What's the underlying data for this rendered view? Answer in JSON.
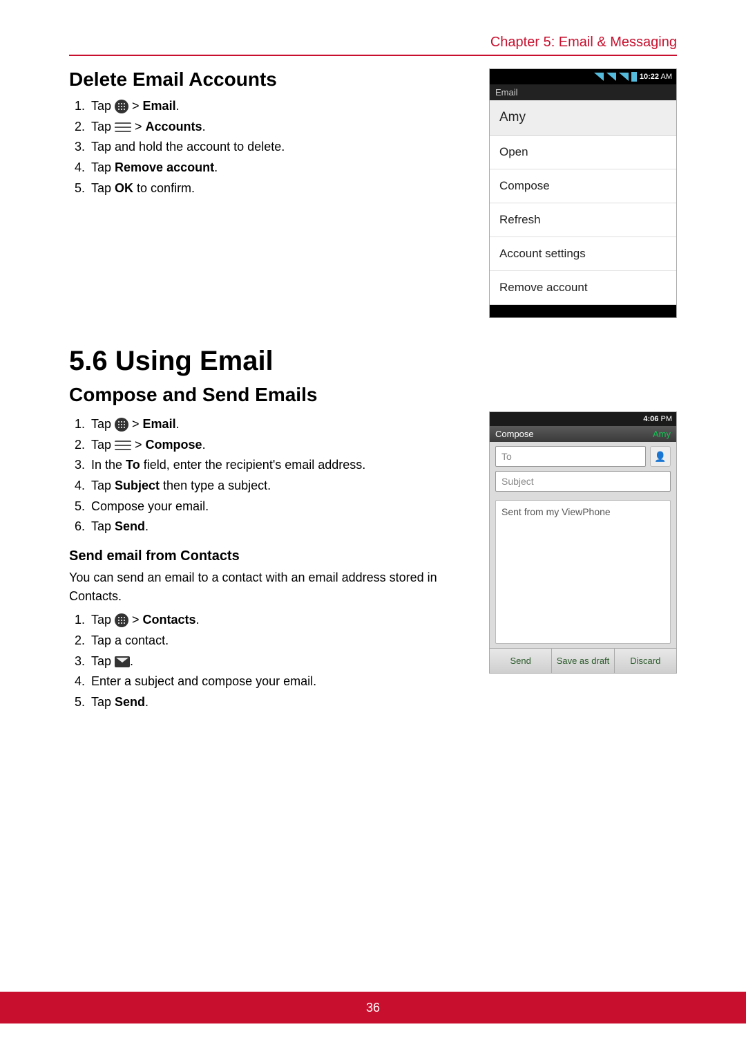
{
  "header": {
    "chapter": "Chapter 5: Email & Messaging"
  },
  "sectionA": {
    "title": "Delete Email Accounts",
    "steps": {
      "s1a": "Tap ",
      "s1b": " > ",
      "s1c": "Email",
      "s1d": ".",
      "s2a": "Tap ",
      "s2b": " > ",
      "s2c": "Accounts",
      "s2d": ".",
      "s3": "Tap and hold the account to delete.",
      "s4a": "Tap ",
      "s4b": "Remove account",
      "s4c": ".",
      "s5a": "Tap ",
      "s5b": "OK",
      "s5c": " to confirm."
    }
  },
  "phone1": {
    "time": "10:22",
    "ampm": "AM",
    "appbar": "Email",
    "header": "Amy",
    "items": [
      "Open",
      "Compose",
      "Refresh",
      "Account settings",
      "Remove account"
    ]
  },
  "major": {
    "title": "5.6 Using Email"
  },
  "sectionB": {
    "title": "Compose and Send Emails",
    "steps": {
      "s1a": "Tap ",
      "s1b": " > ",
      "s1c": "Email",
      "s1d": ".",
      "s2a": "Tap ",
      "s2b": " > ",
      "s2c": "Compose",
      "s2d": ".",
      "s3a": "In the ",
      "s3b": "To",
      "s3c": " field, enter the recipient's email address.",
      "s4a": "Tap ",
      "s4b": "Subject",
      "s4c": " then type a subject.",
      "s5": "Compose your email.",
      "s6a": "Tap ",
      "s6b": "Send",
      "s6c": "."
    },
    "subTitle": "Send email from Contacts",
    "subIntro": "You can send an email to a contact with an email address stored in Contacts.",
    "subSteps": {
      "s1a": "Tap ",
      "s1b": " > ",
      "s1c": "Contacts",
      "s1d": ".",
      "s2": "Tap a contact.",
      "s3a": "Tap ",
      "s3b": ".",
      "s4": "Enter a subject and compose your email.",
      "s5a": "Tap ",
      "s5b": "Send",
      "s5c": "."
    }
  },
  "phone2": {
    "time": "4:06",
    "ampm": "PM",
    "titleLeft": "Compose",
    "titleRight": "Amy",
    "toPlaceholder": "To",
    "subjectPlaceholder": "Subject",
    "bodyText": "Sent from my ViewPhone",
    "buttons": [
      "Send",
      "Save as draft",
      "Discard"
    ]
  },
  "footer": {
    "page": "36"
  }
}
